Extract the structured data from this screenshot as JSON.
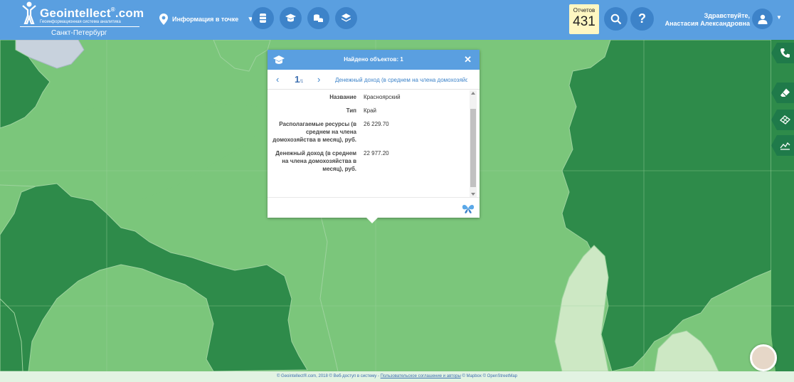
{
  "header": {
    "logo": {
      "name": "Geointellect",
      "suffix": ".com",
      "reg": "®",
      "tagline": "Геоинформационная система аналитика",
      "city": "Санкт-Петербург"
    },
    "info_point_label": "Информация в точке",
    "layer_buttons": [
      {
        "icon": "barrel-icon"
      },
      {
        "icon": "graduation-cap-icon"
      },
      {
        "icon": "coins-icon"
      },
      {
        "icon": "layers-icon"
      }
    ],
    "reports": {
      "label": "Отчетов",
      "count": "431"
    },
    "search_icon": "search-icon",
    "help_label": "?",
    "greeting": {
      "line1": "Здравствуйте,",
      "line2": "Анастасия Александровна"
    },
    "user_caret": "▼"
  },
  "popup": {
    "title": "Найдено объектов: 1",
    "close": "✕",
    "nav": {
      "prev": "‹",
      "page": "1",
      "total": "/1",
      "next": "›",
      "field": "Денежный доход (в среднем на члена домохозяйства в месяц), руб."
    },
    "properties": [
      {
        "key": "Название",
        "value": "Красноярский"
      },
      {
        "key": "Тип",
        "value": "Край"
      },
      {
        "key": "Располагаемые ресурсы (в среднем на члена домохозяйства в месяц), руб.",
        "value": "26 229.70"
      },
      {
        "key": "Денежный доход (в среднем на члена домохозяйства в месяц), руб.",
        "value": "22 977.20"
      }
    ]
  },
  "side_tools": [
    {
      "icon": "phone-icon"
    },
    {
      "icon": "eraser-icon"
    },
    {
      "icon": "grid-map-icon"
    },
    {
      "icon": "chart-line-icon"
    }
  ],
  "footer": {
    "copyright": "© Geointellect®.com, 2018 © Веб-доступ в систему - ",
    "agreement_link": "Пользовательское соглашение и авторы",
    "map_credit": " © Mapbox © OpenStreetMap"
  },
  "colors": {
    "header_bg": "#5a9fe0",
    "button_bg": "#3d83c9",
    "region_light": "#7bc67b",
    "region_dark": "#2e8b4a",
    "region_pale": "#cde8c4",
    "reports_bg": "#fff7c2"
  }
}
